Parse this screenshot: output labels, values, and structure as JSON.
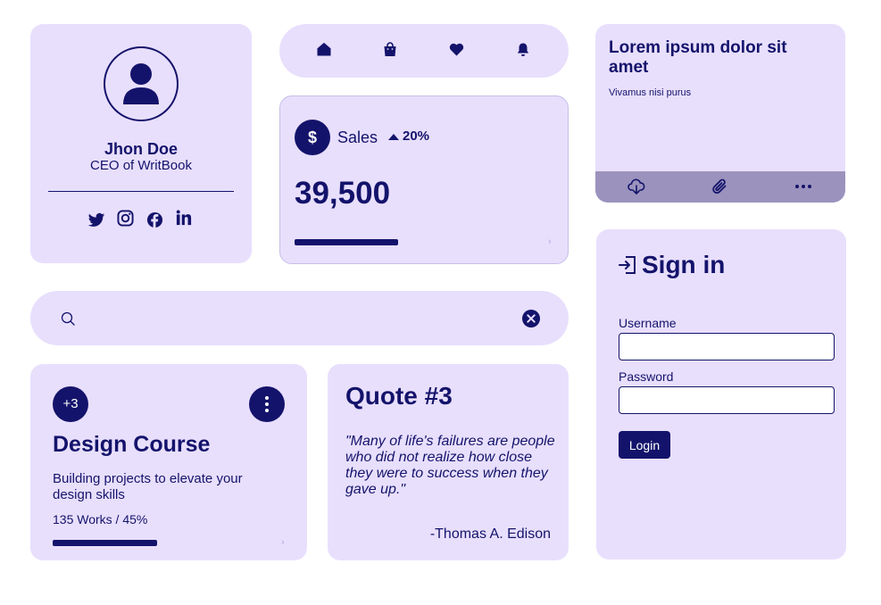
{
  "profile": {
    "name": "Jhon Doe",
    "role": "CEO of WritBook",
    "socials": [
      "twitter-icon",
      "instagram-icon",
      "facebook-icon",
      "linkedin-icon"
    ]
  },
  "navbar": {
    "icons": [
      "home-icon",
      "shopping-bag-icon",
      "heart-icon",
      "bell-icon"
    ]
  },
  "sales": {
    "currency_symbol": "$",
    "label": "Sales",
    "trend": "20%",
    "value": "39,500",
    "progress_fraction": 0.4
  },
  "lorem": {
    "title": "Lorem ipsum dolor sit amet",
    "subtitle": "Vivamus nisi purus",
    "footer_icons": [
      "cloud-download-icon",
      "paperclip-icon",
      "more-horizontal-icon"
    ]
  },
  "search": {
    "placeholder": "",
    "value": ""
  },
  "course": {
    "badge": "+3",
    "title": "Design Course",
    "description": "Building projects to elevate your design skills",
    "stats": "135 Works / 45%",
    "progress_fraction": 0.45
  },
  "quote": {
    "title": "Quote #3",
    "text": "\"Many of life's failures are people who did not realize how close they were to success when they gave up.\"",
    "author": "-Thomas A. Edison"
  },
  "signin": {
    "title": "Sign in",
    "username_label": "Username",
    "username_value": "",
    "password_label": "Password",
    "password_value": "",
    "button_label": "Login"
  },
  "colors": {
    "card_background": "#e8dffd",
    "primary": "#14136b",
    "footer_bar": "#9b93bd"
  }
}
